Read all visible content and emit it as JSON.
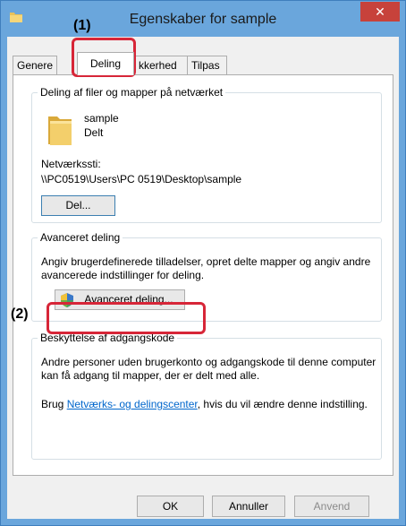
{
  "window": {
    "title": "Egenskaber for sample",
    "close_symbol": "✕"
  },
  "tabs": [
    {
      "label": "Generelt",
      "shown": "Genere",
      "active": false
    },
    {
      "label": "Deling",
      "active": true
    },
    {
      "label": "Sikkerhed",
      "shown": "kkerhed",
      "active": false
    },
    {
      "label": "Tilpas",
      "active": false
    }
  ],
  "sharing_group": {
    "legend": "Deling af filer og mapper på netværket",
    "folder_name": "sample",
    "folder_status": "Delt",
    "network_path_label": "Netværkssti:",
    "network_path": "\\\\PC0519\\Users\\PC 0519\\Desktop\\sample",
    "share_button": "Del..."
  },
  "advanced_group": {
    "legend": "Avanceret deling",
    "description": "Angiv brugerdefinerede tilladelser, opret delte mapper og angiv andre avancerede indstillinger for deling.",
    "button": "Avanceret deling..."
  },
  "password_group": {
    "legend": "Beskyttelse af adgangskode",
    "description": "Andre personer uden brugerkonto og adgangskode til denne computer kan få adgang til mapper, der er delt med alle.",
    "link_prefix": "Brug ",
    "link_text": "Netværks- og delingscenter",
    "link_suffix": ", hvis du vil ændre denne indstilling."
  },
  "footer": {
    "ok": "OK",
    "cancel": "Annuller",
    "apply": "Anvend"
  },
  "callouts": {
    "one": "(1)",
    "two": "(2)"
  },
  "colors": {
    "titlebar": "#6aa6dc",
    "close": "#c7423b",
    "callout": "#d72638",
    "link": "#0066cc",
    "folder": "#e8c15a"
  }
}
